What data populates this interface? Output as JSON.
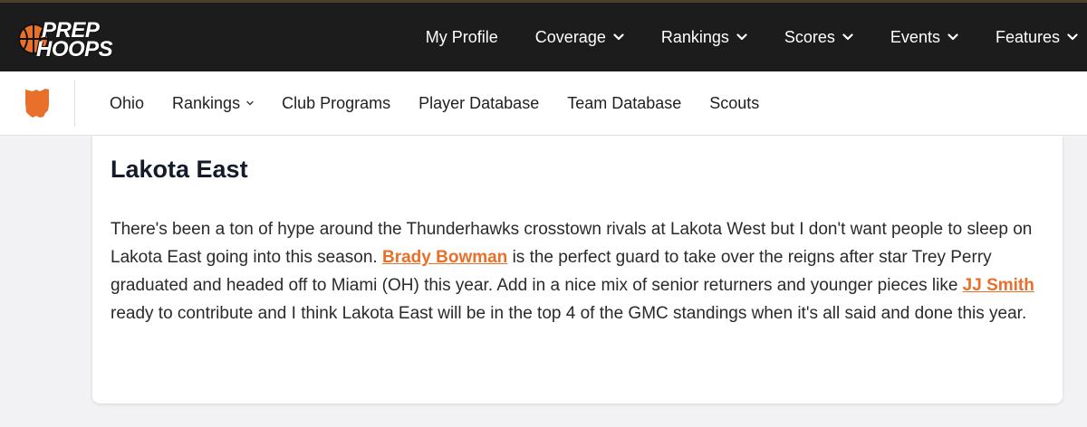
{
  "logo": {
    "line1": "PREP",
    "line2": "HOOPS"
  },
  "topnav": {
    "items": [
      {
        "label": "My Profile",
        "has_dropdown": false
      },
      {
        "label": "Coverage",
        "has_dropdown": true
      },
      {
        "label": "Rankings",
        "has_dropdown": true
      },
      {
        "label": "Scores",
        "has_dropdown": true
      },
      {
        "label": "Events",
        "has_dropdown": true
      },
      {
        "label": "Features",
        "has_dropdown": true
      }
    ]
  },
  "subnav": {
    "state_icon": "ohio-state-icon",
    "items": [
      {
        "label": "Ohio"
      },
      {
        "label": "Rankings",
        "has_dropdown": true
      },
      {
        "label": "Club Programs"
      },
      {
        "label": "Player Database"
      },
      {
        "label": "Team Database"
      },
      {
        "label": "Scouts"
      }
    ]
  },
  "article": {
    "heading": "Lakota East",
    "p1": "There's been a ton of hype around the Thunderhawks crosstown rivals at Lakota West but I don't want people to sleep on Lakota East going into this season. ",
    "link1": "Brady Bowman",
    "p2": " is the perfect guard to take over the reigns after star Trey Perry graduated and headed off to Miami (OH) this year. Add in a nice mix of senior returners and younger pieces like ",
    "link2": "JJ Smith",
    "p3": " ready to contribute and I think Lakota East will be in the top 4 of the GMC standings when it's all said and done this year."
  },
  "colors": {
    "accent": "#e8702a",
    "topnav_bg": "#1c1c1c",
    "page_bg": "#f2f2f4"
  }
}
